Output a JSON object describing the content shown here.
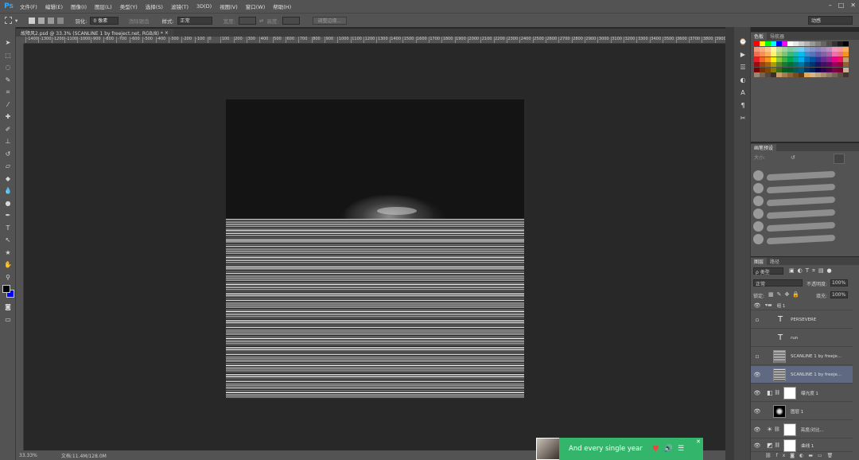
{
  "menubar": {
    "logo": "Ps",
    "items": [
      "文件(F)",
      "编辑(E)",
      "图像(I)",
      "图层(L)",
      "类型(Y)",
      "选择(S)",
      "滤镜(T)",
      "3D(D)",
      "视图(V)",
      "窗口(W)",
      "帮助(H)"
    ]
  },
  "options": {
    "feather_label": "羽化:",
    "feather_value": "0 像素",
    "antialias_label": "消除锯齿",
    "style_label": "样式:",
    "style_value": "正常",
    "width_label": "宽度:",
    "height_label": "高度:",
    "refine_edge": "调整边缘...",
    "workspace": "动感"
  },
  "document": {
    "tab_title": "故障风2.psd @ 33.3% (SCANLINE 1 by freeject.net, RGB/8) *",
    "zoom": "33.33%",
    "doc_size": "文档:11.4M/128.0M"
  },
  "ruler": {
    "labels": [
      "-1400",
      "-1300",
      "-1200",
      "-1100",
      "-1000",
      "-900",
      "-800",
      "-700",
      "-600",
      "-500",
      "-400",
      "-300",
      "-200",
      "-100",
      "0",
      "100",
      "200",
      "300",
      "400",
      "500",
      "600",
      "700",
      "800",
      "900",
      "1000",
      "1100",
      "1200",
      "1300",
      "1400",
      "1500",
      "1600",
      "1700",
      "1800",
      "1900",
      "2000",
      "2100",
      "2200",
      "2300",
      "2400",
      "2500",
      "2600",
      "2700",
      "2800",
      "2900",
      "3000",
      "3100",
      "3200",
      "3300",
      "3400",
      "3500",
      "3600",
      "3700",
      "3800",
      "3900"
    ]
  },
  "panels": {
    "swatches_tabs": [
      "色板",
      "导航器"
    ],
    "brush_tab": "画笔预设",
    "brush_size_label": "大小:",
    "layers_tabs": [
      "图层",
      "路径"
    ],
    "kind_filter": "ρ 类型",
    "blend_mode": "正常",
    "opacity_label": "不透明度:",
    "opacity_value": "100%",
    "lock_label": "锁定:",
    "fill_label": "填充:",
    "fill_value": "100%"
  },
  "layers": [
    {
      "name": "组 1",
      "visible": true
    },
    {
      "name": "PERSEVERE",
      "visible": false
    },
    {
      "name": "run",
      "visible": false
    },
    {
      "name": "SCANLINE 1 by freeje...",
      "visible": false
    },
    {
      "name": "SCANLINE 1 by freeje...",
      "visible": true
    },
    {
      "name": "曝光度 1",
      "visible": true
    },
    {
      "name": "图层 1",
      "visible": true
    },
    {
      "name": "亮度/对比...",
      "visible": true
    },
    {
      "name": "曲线 1",
      "visible": true
    }
  ],
  "music": {
    "title": "And every single year"
  },
  "colors": {
    "foreground": "#000000",
    "background": "#0000ff",
    "music_bg": "#33b56b",
    "selected_layer": "#5f6a82"
  }
}
